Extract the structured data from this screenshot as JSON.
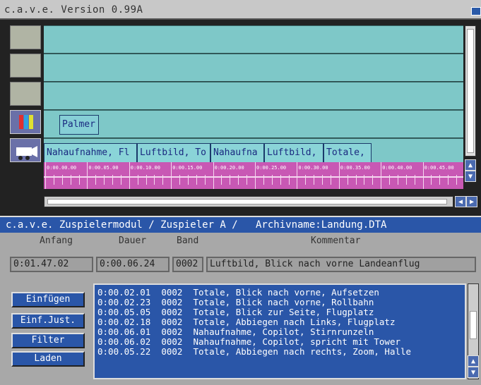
{
  "window": {
    "title": "c.a.v.e. Version 0.99A"
  },
  "tracks": {
    "title_clips": [
      "Palmer"
    ],
    "video_clips": [
      "Nahaufnahme, Fl",
      "Luftbild, To",
      "Nahaufna",
      "Luftbild, ",
      "Totale,"
    ]
  },
  "ruler": {
    "labels": [
      "0:00.00.00",
      "0:00.05.00",
      "0:00.10.00",
      "0:00.15.00",
      "0:00.20.00",
      "0:00.25.00",
      "0:00.30.00",
      "0:00.35.00",
      "0:00.40.00",
      "0:00.45.00"
    ]
  },
  "module": {
    "title": "c.a.v.e. Zuspielermodul / Zuspieler A /   Archivname:Landung.DTA"
  },
  "fields": {
    "headers": {
      "anfang": "Anfang",
      "dauer": "Dauer",
      "band": "Band",
      "kommentar": "Kommentar"
    },
    "anfang": "0:01.47.02",
    "dauer": "0:00.06.24",
    "band": "0002",
    "kommentar": "Luftbild, Blick nach vorne Landeanflug"
  },
  "buttons": {
    "einfuegen": "Einfügen",
    "einf_just": "Einf.Just.",
    "filter": "Filter",
    "laden": "Laden"
  },
  "list": [
    {
      "time": "0:00.02.01",
      "band": "0002",
      "text": "Totale, Blick nach vorne, Aufsetzen"
    },
    {
      "time": "0:00.02.23",
      "band": "0002",
      "text": "Totale, Blick nach vorne, Rollbahn"
    },
    {
      "time": "0:00.05.05",
      "band": "0002",
      "text": "Totale, Blick zur Seite, Flugplatz"
    },
    {
      "time": "0:00.02.18",
      "band": "0002",
      "text": "Totale, Abbiegen nach Links, Flugplatz"
    },
    {
      "time": "0:00.06.01",
      "band": "0002",
      "text": "Nahaufnahme, Copilot, Stirnrunzeln"
    },
    {
      "time": "0:00.06.02",
      "band": "0002",
      "text": "Nahaufnahme, Copilot, spricht mit Tower"
    },
    {
      "time": "0:00.05.22",
      "band": "0002",
      "text": "Totale, Abbiegen nach rechts, Zoom, Halle"
    }
  ],
  "colors": {
    "track": "#7ec8c8",
    "ruler": "#c858b4",
    "accent": "#2a56a8",
    "panel": "#a8a8a8"
  }
}
